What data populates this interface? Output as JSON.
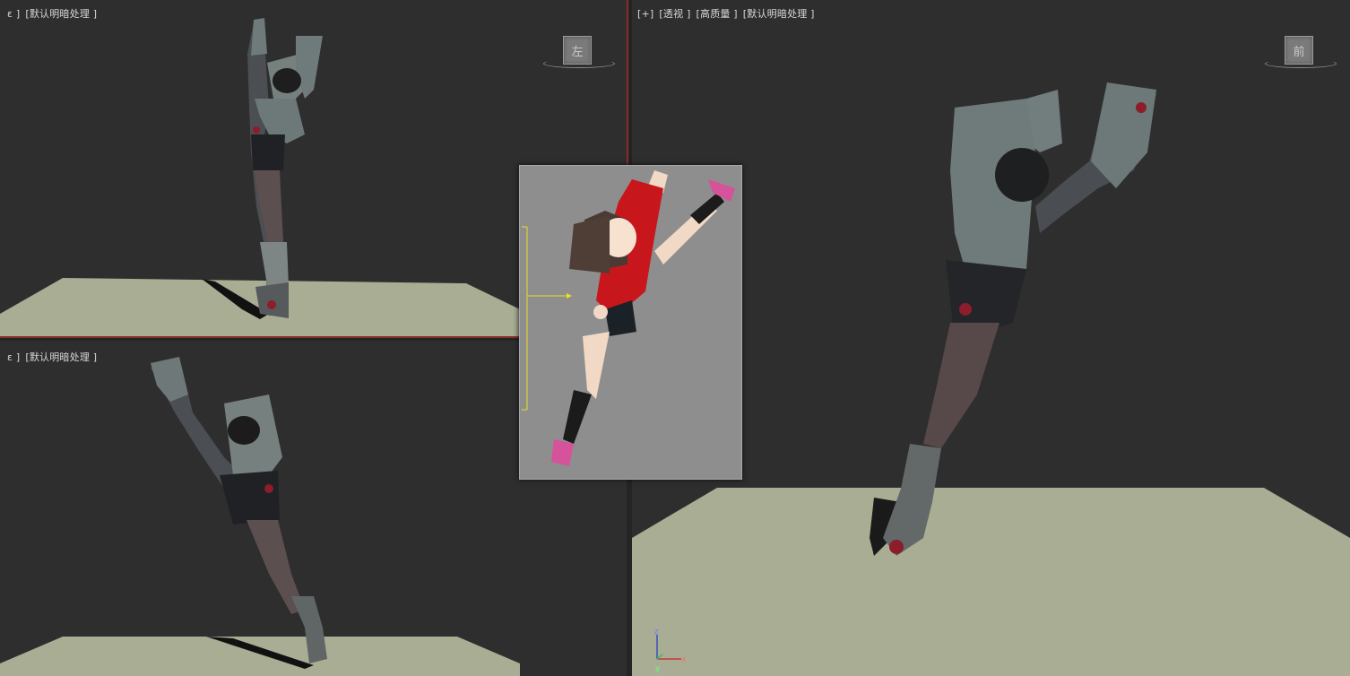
{
  "viewports": {
    "top_left": {
      "labels": [
        "ε ]",
        "[默认明暗处理 ]"
      ],
      "viewcube_face": "左"
    },
    "bottom_left": {
      "labels": [
        "ε ]",
        "[默认明暗处理 ]"
      ]
    },
    "right": {
      "labels": [
        "[+]",
        "[透视 ]",
        "[高质量 ]",
        "[默认明暗处理 ]"
      ],
      "viewcube_face": "前"
    }
  },
  "axis_gizmo": {
    "z": "z",
    "x": "x",
    "y": "y"
  },
  "colors": {
    "viewport_bg": "#2e2e2e",
    "ground": "#a9ad94",
    "active_border": "#8b2c2c",
    "reference_bg": "#8e8e8e"
  }
}
